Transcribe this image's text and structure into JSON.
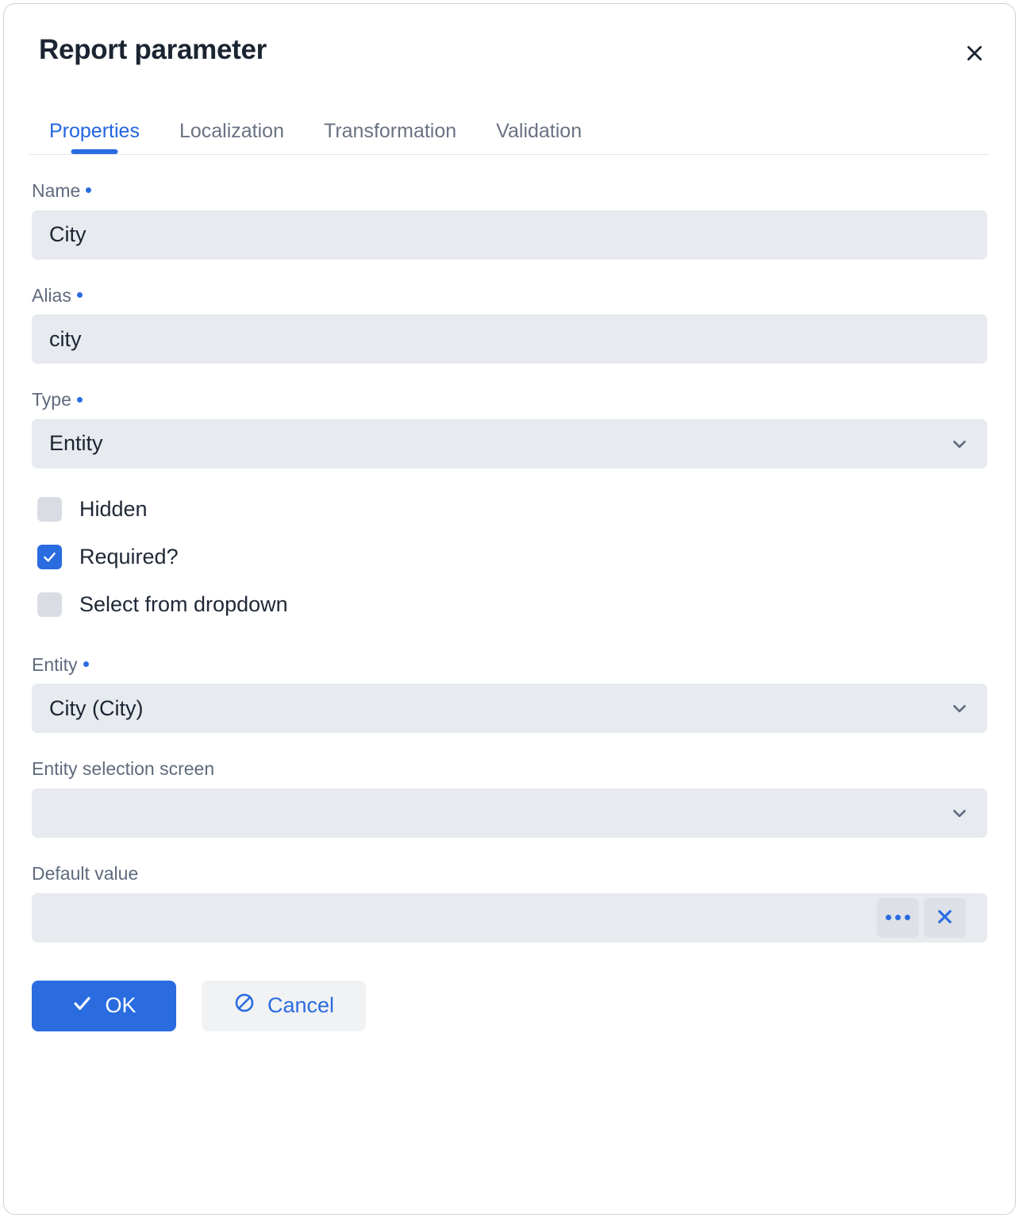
{
  "dialog": {
    "title": "Report parameter",
    "close_icon": "close-icon"
  },
  "tabs": [
    {
      "label": "Properties",
      "active": true
    },
    {
      "label": "Localization",
      "active": false
    },
    {
      "label": "Transformation",
      "active": false
    },
    {
      "label": "Validation",
      "active": false
    }
  ],
  "fields": {
    "name": {
      "label": "Name",
      "required": true,
      "value": "City",
      "placeholder": ""
    },
    "alias": {
      "label": "Alias",
      "required": true,
      "value": "city",
      "placeholder": ""
    },
    "type": {
      "label": "Type",
      "required": true,
      "value": "Entity",
      "chevron_icon": "chevron-down-icon"
    },
    "entity": {
      "label": "Entity",
      "required": true,
      "value": "City (City)",
      "chevron_icon": "chevron-down-icon"
    },
    "entity_selection_screen": {
      "label": "Entity selection screen",
      "required": false,
      "value": "",
      "chevron_icon": "chevron-down-icon"
    },
    "default_value": {
      "label": "Default value",
      "required": false,
      "value": "",
      "ellipsis_label": "...",
      "clear_icon": "close-icon"
    }
  },
  "checkboxes": [
    {
      "label": "Hidden",
      "checked": false
    },
    {
      "label": "Required?",
      "checked": true
    },
    {
      "label": "Select from dropdown",
      "checked": false
    }
  ],
  "footer": {
    "ok_label": "OK",
    "ok_icon": "check-icon",
    "cancel_label": "Cancel",
    "cancel_icon": "ban-icon"
  },
  "colors": {
    "accent": "#2a6ce0",
    "field_bg": "#e7eaee",
    "text": "#1b2432",
    "label": "#5f6a7d",
    "tab_inactive": "#6a7383",
    "checkbox_unchecked": "#d9dde3"
  }
}
